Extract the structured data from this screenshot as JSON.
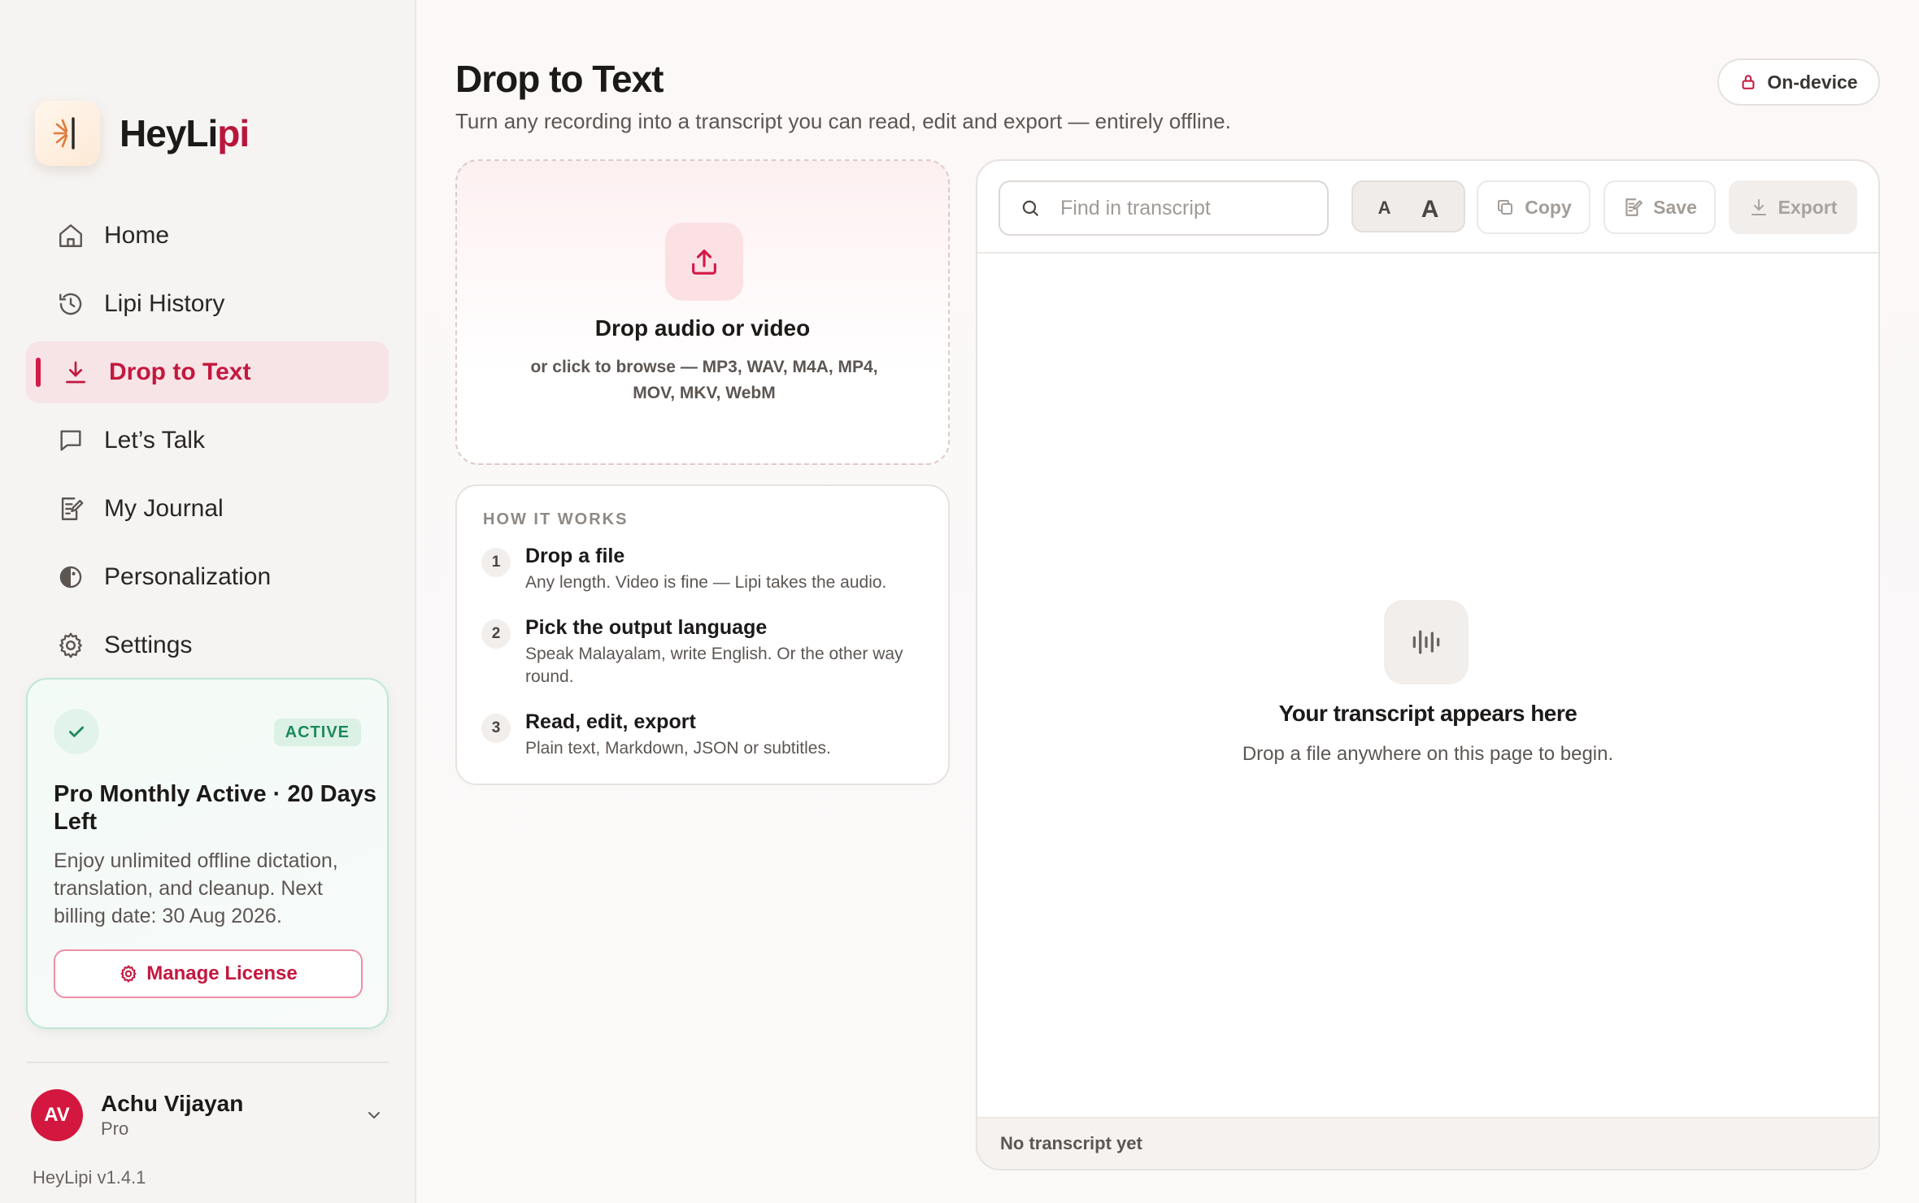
{
  "brand": {
    "name_main": "HeyLi",
    "name_accent": "pi"
  },
  "nav": {
    "items": [
      {
        "label": "Home",
        "icon": "home-icon"
      },
      {
        "label": "Lipi History",
        "icon": "history-icon"
      },
      {
        "label": "Drop to Text",
        "icon": "download-icon",
        "active": true
      },
      {
        "label": "Let’s Talk",
        "icon": "chat-icon"
      },
      {
        "label": "My Journal",
        "icon": "journal-icon"
      },
      {
        "label": "Personalization",
        "icon": "palette-icon"
      },
      {
        "label": "Settings",
        "icon": "gear-icon"
      }
    ]
  },
  "license": {
    "badge": "ACTIVE",
    "title": "Pro Monthly Active · 20 Days Left",
    "description": "Enjoy unlimited offline dictation, translation, and cleanup. Next billing date: 30 Aug 2026.",
    "button": "Manage License"
  },
  "user": {
    "initials": "AV",
    "name": "Achu Vijayan",
    "plan": "Pro"
  },
  "version": "HeyLipi v1.4.1",
  "page": {
    "title": "Drop to Text",
    "subtitle": "Turn any recording into a transcript you can read, edit and export — entirely offline.",
    "badge": "On-device"
  },
  "drop": {
    "title": "Drop audio or video",
    "description": "or click to browse — MP3, WAV, M4A, MP4, MOV, MKV, WebM"
  },
  "how": {
    "heading": "HOW IT WORKS",
    "steps": [
      {
        "num": "1",
        "title": "Drop a file",
        "desc": "Any length. Video is fine — Lipi takes the audio."
      },
      {
        "num": "2",
        "title": "Pick the output language",
        "desc": "Speak Malayalam, write English. Or the other way round."
      },
      {
        "num": "3",
        "title": "Read, edit, export",
        "desc": "Plain text, Markdown, JSON or subtitles."
      }
    ]
  },
  "transcript": {
    "search_placeholder": "Find in transcript",
    "font_small": "A",
    "font_large": "A",
    "copy": "Copy",
    "save": "Save",
    "export": "Export",
    "empty_title": "Your transcript appears here",
    "empty_desc": "Drop a file anywhere on this page to begin.",
    "status": "No transcript yet"
  },
  "colors": {
    "accent": "#c4173f",
    "active_bg": "#f7e4e6",
    "success": "#1c8a5b"
  }
}
